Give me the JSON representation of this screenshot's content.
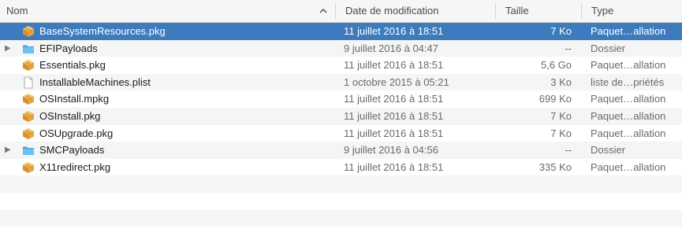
{
  "header": {
    "name": "Nom",
    "date": "Date de modification",
    "size": "Taille",
    "kind": "Type"
  },
  "files": [
    {
      "name": "BaseSystemResources.pkg",
      "date": "11 juillet 2016 à 18:51",
      "size": "7 Ko",
      "kind": "Paquet…allation",
      "icon": "package-icon",
      "folder": false,
      "selected": true
    },
    {
      "name": "EFIPayloads",
      "date": "9 juillet 2016 à 04:47",
      "size": "--",
      "kind": "Dossier",
      "icon": "folder-icon",
      "folder": true,
      "selected": false
    },
    {
      "name": "Essentials.pkg",
      "date": "11 juillet 2016 à 18:51",
      "size": "5,6 Go",
      "kind": "Paquet…allation",
      "icon": "package-icon",
      "folder": false,
      "selected": false
    },
    {
      "name": "InstallableMachines.plist",
      "date": "1 octobre 2015 à 05:21",
      "size": "3 Ko",
      "kind": "liste de…priétés",
      "icon": "document-icon",
      "folder": false,
      "selected": false
    },
    {
      "name": "OSInstall.mpkg",
      "date": "11 juillet 2016 à 18:51",
      "size": "699 Ko",
      "kind": "Paquet…allation",
      "icon": "package-icon",
      "folder": false,
      "selected": false
    },
    {
      "name": "OSInstall.pkg",
      "date": "11 juillet 2016 à 18:51",
      "size": "7 Ko",
      "kind": "Paquet…allation",
      "icon": "package-icon",
      "folder": false,
      "selected": false
    },
    {
      "name": "OSUpgrade.pkg",
      "date": "11 juillet 2016 à 18:51",
      "size": "7 Ko",
      "kind": "Paquet…allation",
      "icon": "package-icon",
      "folder": false,
      "selected": false
    },
    {
      "name": "SMCPayloads",
      "date": "9 juillet 2016 à 04:56",
      "size": "--",
      "kind": "Dossier",
      "icon": "folder-icon",
      "folder": true,
      "selected": false
    },
    {
      "name": "X11redirect.pkg",
      "date": "11 juillet 2016 à 18:51",
      "size": "335 Ko",
      "kind": "Paquet…allation",
      "icon": "package-icon",
      "folder": false,
      "selected": false
    }
  ],
  "colors": {
    "selection": "#3d7bbd",
    "stripe": "#f4f5f5",
    "package": "#e8a33d",
    "folder": "#5eb5ee"
  }
}
